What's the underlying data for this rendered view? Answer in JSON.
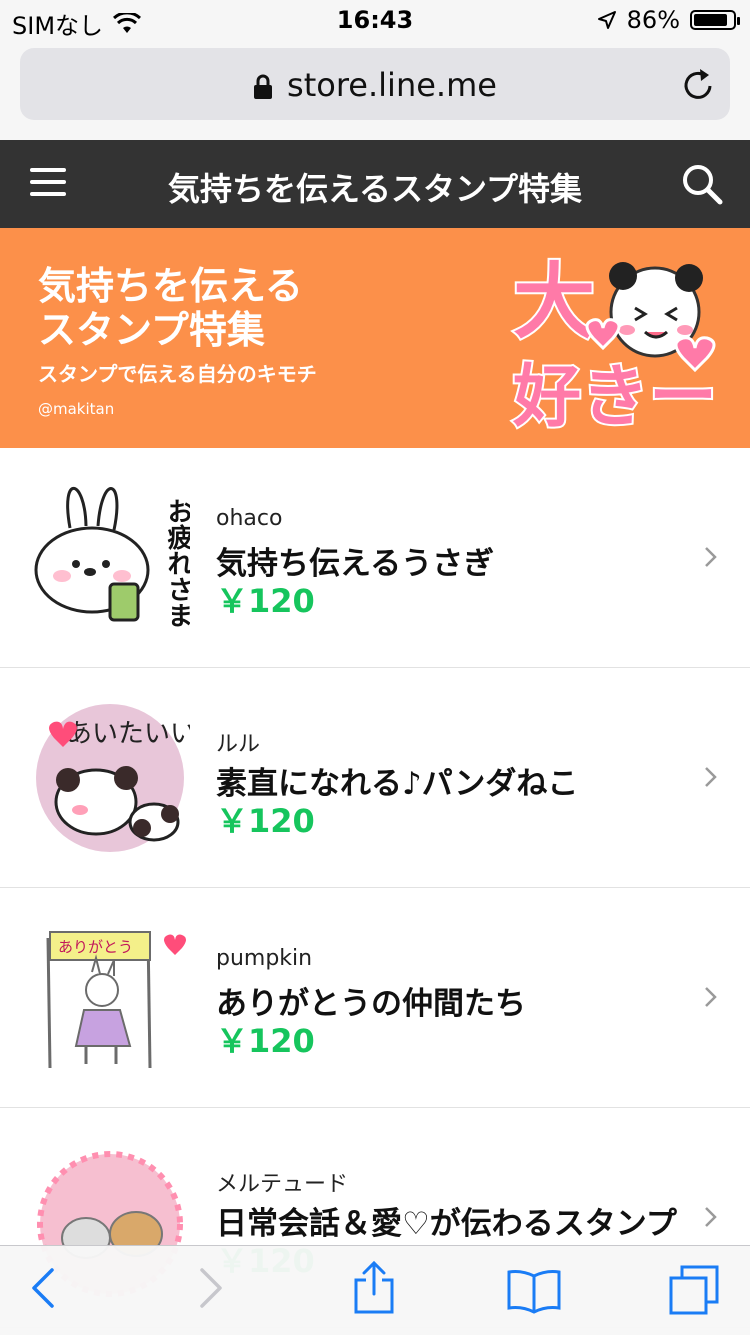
{
  "status": {
    "carrier": "SIMなし",
    "time": "16:43",
    "battery": "86%"
  },
  "browser": {
    "url": "store.line.me"
  },
  "header": {
    "title": "気持ちを伝えるスタンプ特集"
  },
  "banner": {
    "title_line1": "気持ちを伝える",
    "title_line2": "スタンプ特集",
    "subtitle": "スタンプで伝える自分のキモチ",
    "credit": "@makitan",
    "art_text_1": "大",
    "art_text_2": "好きー"
  },
  "thumb_text": {
    "item1": "お疲れさま",
    "item2": "あいたいい",
    "item3": "ありがとう"
  },
  "items": [
    {
      "author": "ohaco",
      "name": "気持ち伝えるうさぎ",
      "price": "￥120"
    },
    {
      "author": "ルル",
      "name": "素直になれる♪パンダねこ",
      "price": "￥120"
    },
    {
      "author": "pumpkin",
      "name": "ありがとうの仲間たち",
      "price": "￥120"
    },
    {
      "author": "メルテュード",
      "name": "日常会話＆愛♡が伝わるスタンプ",
      "price": "￥120"
    }
  ],
  "colors": {
    "header": "#333333",
    "banner": "#fc904a",
    "price": "#16c55d",
    "ios_blue": "#1a7cf5"
  }
}
